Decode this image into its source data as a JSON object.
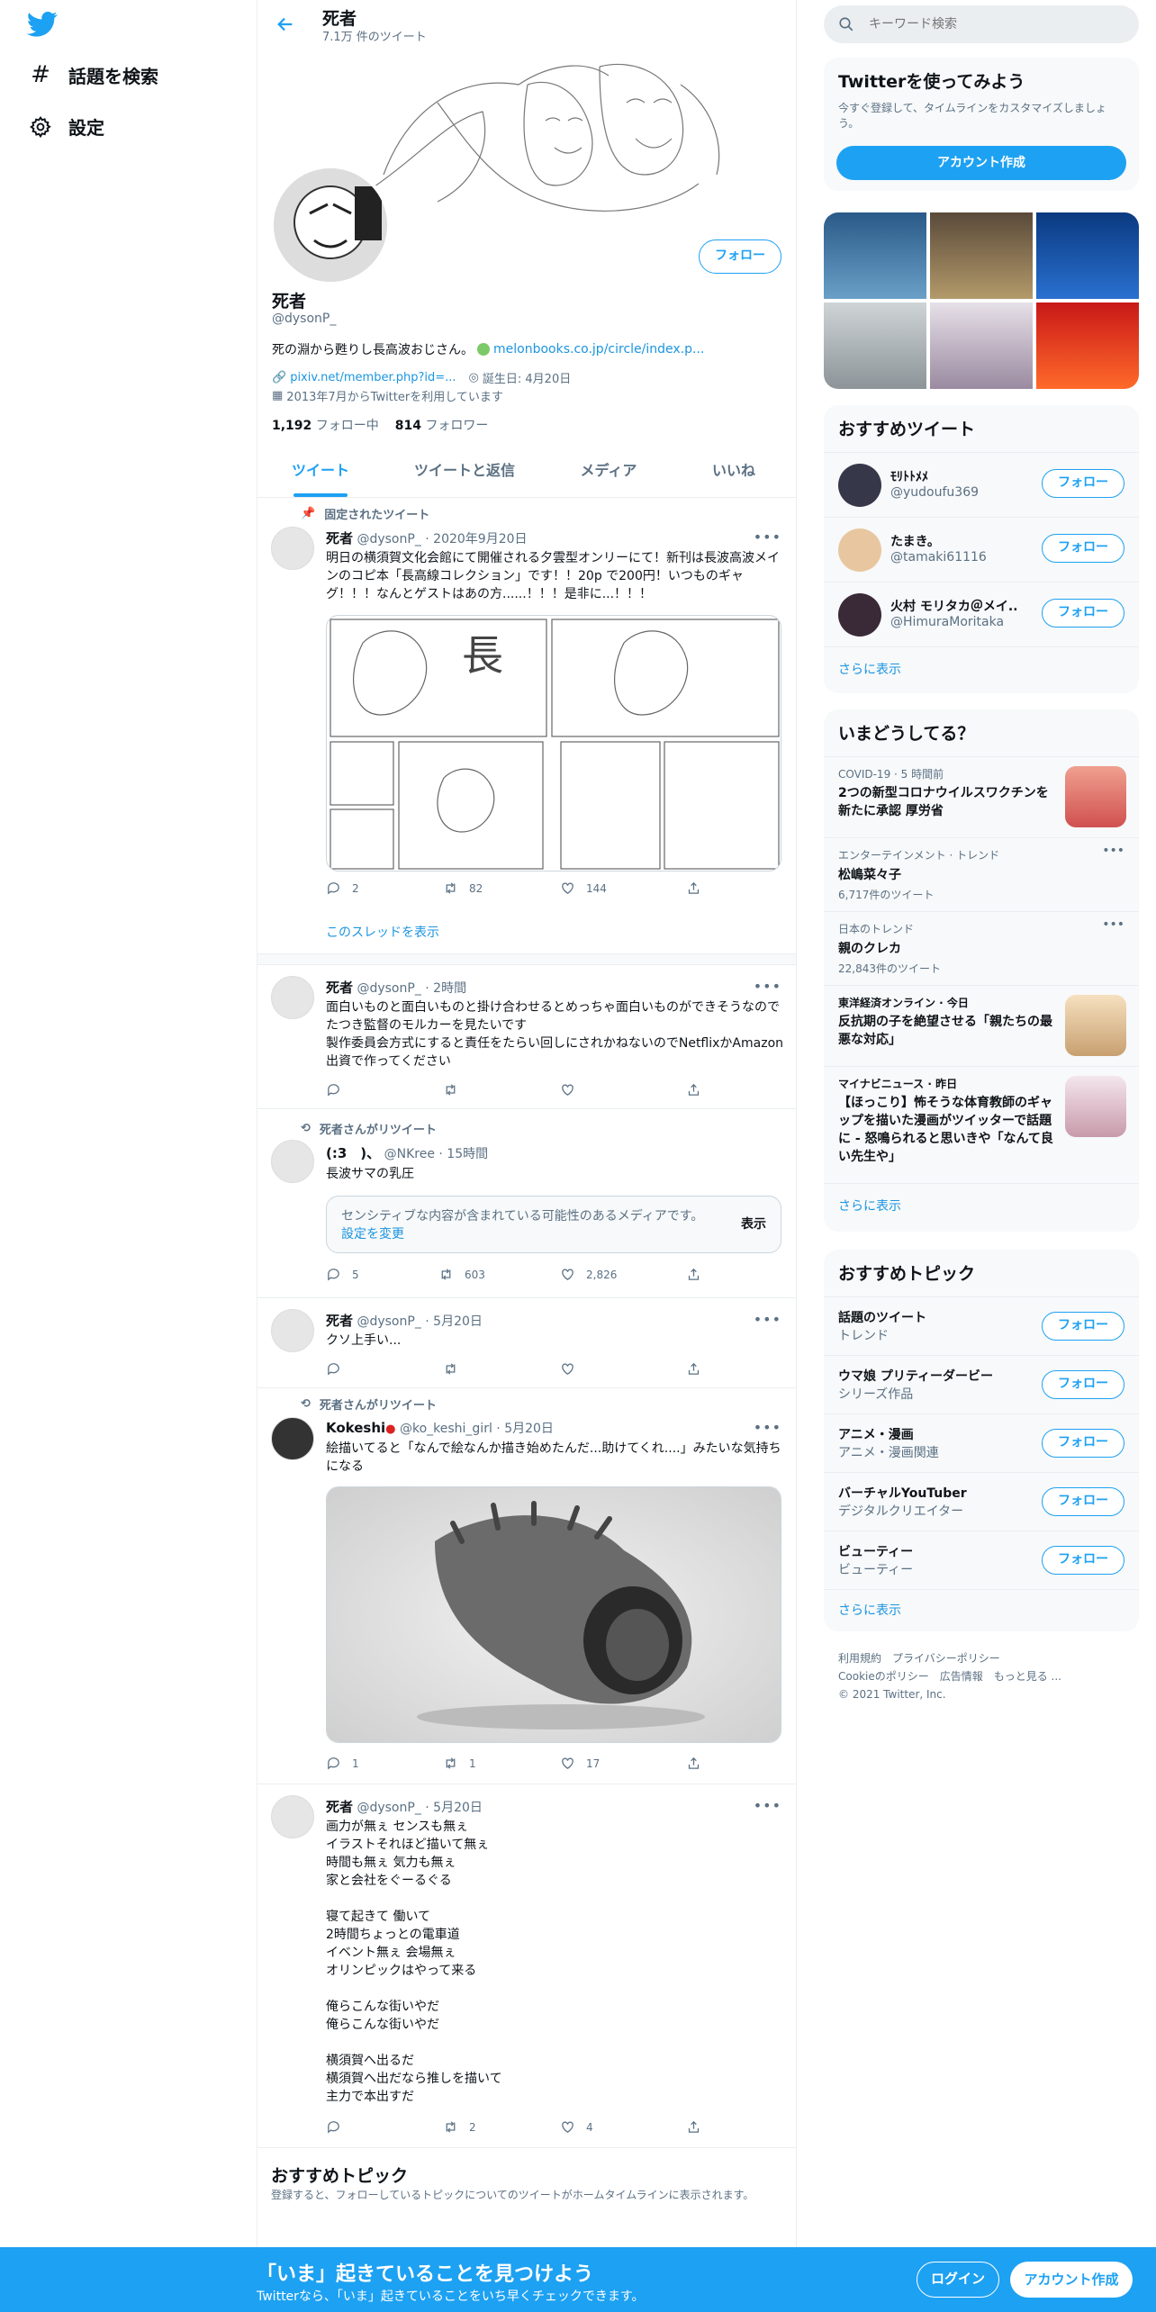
{
  "nav": {
    "explore_label": "話題を検索",
    "settings_label": "設定"
  },
  "header": {
    "name": "死者",
    "tweet_count": "7.1万 件のツイート"
  },
  "profile": {
    "name": "死者",
    "handle": "@dysonP_",
    "bio": "死の淵から甦りし長高波おじさん。",
    "bio_link": "melonbooks.co.jp/circle/index.p...",
    "website": "pixiv.net/member.php?id=...",
    "birthday": "誕生日: 4月20日",
    "joined": "2013年7月からTwitterを利用しています",
    "following_count": "1,192",
    "following_label": "フォロー中",
    "followers_count": "814",
    "followers_label": "フォロワー",
    "follow_button": "フォロー"
  },
  "tabs": [
    "ツイート",
    "ツイートと返信",
    "メディア",
    "いいね"
  ],
  "tweets": [
    {
      "pinned_label": "固定されたツイート",
      "name": "死者",
      "meta": "@dysonP_ · 2020年9月20日",
      "text": "明日の横須賀文化会館にて開催される夕雲型オンリーにて！新刊は長波高波メインのコピ本「長高線コレクション」です！！20p で200円！いつものギャグ！！！なんとゲストはあの方......！！！是非に...！！！",
      "reply": "2",
      "retweet": "82",
      "like": "144",
      "thread_link": "このスレッドを表示"
    },
    {
      "name": "死者",
      "meta": "@dysonP_ · 2時間",
      "text": "面白いものと面白いものと掛け合わせるとめっちゃ面白いものができそうなのでたつき監督のモルカーを見たいです\n製作委員会方式にすると責任をたらい回しにされかねないのでNetflixかAmazon出資で作ってください"
    },
    {
      "rt_label": "死者さんがリツイート",
      "name": "(:3　)、",
      "meta": "@NKree · 15時間",
      "text": "長波サマの乳圧",
      "sensitive_text": "センシティブな内容が含まれている可能性のあるメディアです。",
      "sensitive_link": "設定を変更",
      "sensitive_button": "表示",
      "reply": "5",
      "retweet": "603",
      "like": "2,826"
    },
    {
      "name": "死者",
      "meta": "@dysonP_ · 5月20日",
      "text": "クソ上手い..."
    },
    {
      "rt_label": "死者さんがリツイート",
      "name": "Kokeshi",
      "meta": "@ko_keshi_girl · 5月20日",
      "text": "絵描いてると「なんで絵なんか描き始めたんだ...助けてくれ....」みたいな気持ちになる",
      "reply": "1",
      "retweet": "1",
      "like": "17"
    },
    {
      "name": "死者",
      "meta": "@dysonP_ · 5月20日",
      "text": "画力が無ぇ センスも無ぇ\nイラストそれほど描いて無ぇ\n時間も無ぇ 気力も無ぇ\n家と会社をぐーるぐる\n\n寝て起きて 働いて\n2時間ちょっとの電車道\nイベント無ぇ 会場無ぇ\nオリンピックはやって来る\n\n俺らこんな街いやだ\n俺らこんな街いやだ\n\n横須賀へ出るだ\n横須賀へ出だなら推しを描いて\n主力で本出すだ",
      "retweet": "2",
      "like": "4"
    }
  ],
  "recommend_topics_main": {
    "title": "おすすめトピック",
    "desc": "登録すると、フォローしているトピックについてのツイートがホームタイムラインに表示されます。"
  },
  "search": {
    "placeholder": "キーワード検索"
  },
  "signup_card": {
    "title": "Twitterを使ってみよう",
    "desc": "今すぐ登録して、タイムラインをカスタマイズしましょう。",
    "button": "アカウント作成"
  },
  "who_to_follow": {
    "title": "おすすめツイート",
    "users": [
      {
        "name": "ﾓﾘﾄﾄﾒﾒ",
        "handle": "@yudoufu369"
      },
      {
        "name": "たまき。",
        "handle": "@tamaki61116"
      },
      {
        "name": "火村 モリタカ＠メイ...",
        "handle": "@HimuraMoritaka"
      }
    ],
    "follow_label": "フォロー",
    "more": "さらに表示"
  },
  "trends": {
    "title": "いまどうしてる？",
    "items": [
      {
        "meta": "COVID-19 · 5 時間前",
        "title": "2つの新型コロナウイルスワクチンを新たに承認 厚労省"
      },
      {
        "meta": "エンターテインメント · トレンド",
        "title": "松嶋菜々子",
        "count": "6,717件のツイート"
      },
      {
        "meta": "日本のトレンド",
        "title": "親のクレカ",
        "count": "22,843件のツイート"
      },
      {
        "meta": "東洋経済オンライン · 今日",
        "title": "反抗期の子を絶望させる「親たちの最悪な対応」"
      },
      {
        "meta": "マイナビニュース · 昨日",
        "title": "【ほっこり】怖そうな体育教師のギャップを描いた漫画がツイッターで話題に - 怒鳴られると思いきや「なんて良い先生や」"
      }
    ],
    "more": "さらに表示"
  },
  "topics": {
    "title": "おすすめトピック",
    "items": [
      {
        "name": "話題のツイート",
        "cat": "トレンド"
      },
      {
        "name": "ウマ娘 プリティーダービー",
        "cat": "シリーズ作品"
      },
      {
        "name": "アニメ・漫画",
        "cat": "アニメ・漫画関連"
      },
      {
        "name": "バーチャルYouTuber",
        "cat": "デジタルクリエイター"
      },
      {
        "name": "ビューティー",
        "cat": "ビューティー"
      }
    ],
    "follow_label": "フォロー",
    "more": "さらに表示"
  },
  "footer": {
    "links1": "利用規約　プライバシーポリシー",
    "links2": "Cookieのポリシー　広告情報　もっと見る ...",
    "copyright": "© 2021 Twitter, Inc."
  },
  "bottom_bar": {
    "title": "「いま」起きていることを見つけよう",
    "subtitle": "Twitterなら、「いま」起きていることをいち早くチェックできます。",
    "login": "ログイン",
    "signup": "アカウント作成"
  },
  "colors": {
    "accent": "#1da1f2",
    "link": "#1b95e0",
    "muted": "#5b7083"
  }
}
